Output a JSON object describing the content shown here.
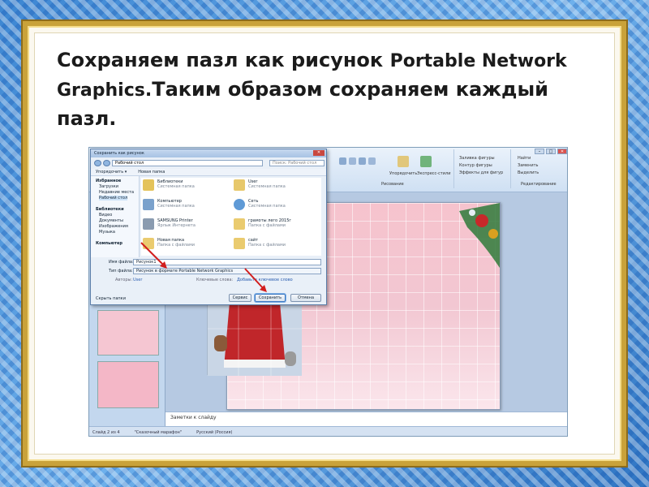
{
  "slide": {
    "title_part1": "Сохраняем пазл как рисунок ",
    "title_part2": "Portable Network Graphics.",
    "title_part3": "Таким образом сохраняем каждый пазл."
  },
  "ppt": {
    "notes_placeholder": "Заметки к слайду",
    "status": {
      "slide": "Слайд 2 из 4",
      "theme": "\"Сказочный марафон\"",
      "lang": "Русский (Россия)"
    },
    "ribbon": {
      "shape_fill": "Заливка фигуры",
      "shape_outline": "Контур фигуры",
      "shape_effects": "Эффекты для фигур",
      "find": "Найти",
      "replace": "Заменить",
      "select": "Выделить",
      "drawing": "Рисование",
      "editing": "Редактирование",
      "express_styles": "Экспресс-стили",
      "arrange": "Упорядочить"
    }
  },
  "dialog": {
    "title": "Сохранить как рисунок",
    "close": "✕",
    "address": "Рабочий стол",
    "search_placeholder": "Поиск: Рабочий стол",
    "toolbar": {
      "organize": "Упорядочить ▾",
      "new_folder": "Новая папка"
    },
    "nav": {
      "favorites": "Избранное",
      "downloads": "Загрузки",
      "recent": "Недавние места",
      "desktop": "Рабочий стол",
      "libraries": "Библиотеки",
      "video": "Видео",
      "documents": "Документы",
      "images": "Изображения",
      "music": "Музыка",
      "computer": "Компьютер"
    },
    "files": [
      {
        "name": "Библиотеки",
        "desc": "Системная папка"
      },
      {
        "name": "User",
        "desc": "Системная папка"
      },
      {
        "name": "Компьютер",
        "desc": "Системная папка"
      },
      {
        "name": "Сеть",
        "desc": "Системная папка"
      },
      {
        "name": "SAMSUNG Printer",
        "desc": "Ярлык Интернета"
      },
      {
        "name": "грамоты лего 2015г",
        "desc": "Папка с файлами"
      },
      {
        "name": "Новая папка",
        "desc": "Папка с файлами"
      },
      {
        "name": "сайт",
        "desc": "Папка с файлами"
      }
    ],
    "file_name_label": "Имя файла:",
    "file_name_value": "Рисунок1",
    "file_type_label": "Тип файла:",
    "file_type_value": "Рисунок в формате Portable Network Graphics",
    "authors_label": "Авторы:",
    "authors_value": "User",
    "keywords_label": "Ключевые слова:",
    "keywords_value": "Добавьте ключевое слово",
    "hide_folders": "Скрыть папки",
    "service": "Сервис",
    "save": "Сохранить",
    "cancel": "Отмена"
  },
  "colors": {
    "accent_arrow": "#d21e1e",
    "gold_frame": "#c9a23a",
    "slide_pink": "#f4c3ce"
  }
}
